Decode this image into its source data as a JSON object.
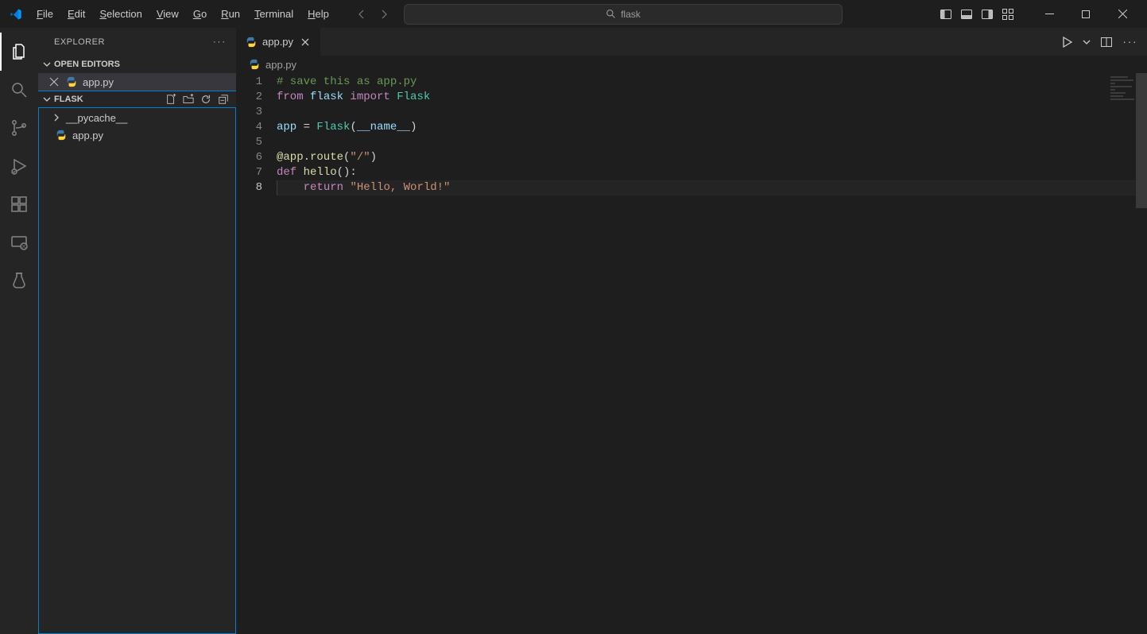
{
  "menu": {
    "file": "File",
    "edit": "Edit",
    "selection": "Selection",
    "view": "View",
    "go": "Go",
    "run": "Run",
    "terminal": "Terminal",
    "help": "Help"
  },
  "search": {
    "text": "flask"
  },
  "sidebar": {
    "title": "EXPLORER",
    "open_editors_label": "OPEN EDITORS",
    "project_label": "FLASK",
    "open_editors": [
      {
        "name": "app.py"
      }
    ],
    "files": [
      {
        "name": "__pycache__",
        "type": "folder"
      },
      {
        "name": "app.py",
        "type": "python"
      }
    ]
  },
  "tabs": [
    {
      "name": "app.py"
    }
  ],
  "breadcrumb": {
    "file": "app.py"
  },
  "code": {
    "lines": [
      {
        "n": 1,
        "tokens": [
          {
            "t": "# save this as app.py",
            "c": "comment"
          }
        ]
      },
      {
        "n": 2,
        "tokens": [
          {
            "t": "from",
            "c": "keyword"
          },
          {
            "t": " flask ",
            "c": "ident"
          },
          {
            "t": "import",
            "c": "keyword"
          },
          {
            "t": " Flask",
            "c": "type"
          }
        ]
      },
      {
        "n": 3,
        "tokens": []
      },
      {
        "n": 4,
        "tokens": [
          {
            "t": "app ",
            "c": "ident"
          },
          {
            "t": "=",
            "c": "punc"
          },
          {
            "t": " Flask",
            "c": "type"
          },
          {
            "t": "(",
            "c": "punc"
          },
          {
            "t": "__name__",
            "c": "param"
          },
          {
            "t": ")",
            "c": "punc"
          }
        ]
      },
      {
        "n": 5,
        "tokens": []
      },
      {
        "n": 6,
        "tokens": [
          {
            "t": "@app.route",
            "c": "deco"
          },
          {
            "t": "(",
            "c": "punc"
          },
          {
            "t": "\"/\"",
            "c": "string"
          },
          {
            "t": ")",
            "c": "punc"
          }
        ]
      },
      {
        "n": 7,
        "tokens": [
          {
            "t": "def ",
            "c": "keyword"
          },
          {
            "t": "hello",
            "c": "func"
          },
          {
            "t": "():",
            "c": "punc"
          }
        ]
      },
      {
        "n": 8,
        "indent": 1,
        "current": true,
        "tokens": [
          {
            "t": "    ",
            "c": "punc"
          },
          {
            "t": "return",
            "c": "keyword"
          },
          {
            "t": " ",
            "c": "punc"
          },
          {
            "t": "\"Hello, World!\"",
            "c": "string"
          }
        ]
      }
    ]
  },
  "icons": {
    "python_color": "#3d7aab",
    "folder_color": "#c09553"
  }
}
